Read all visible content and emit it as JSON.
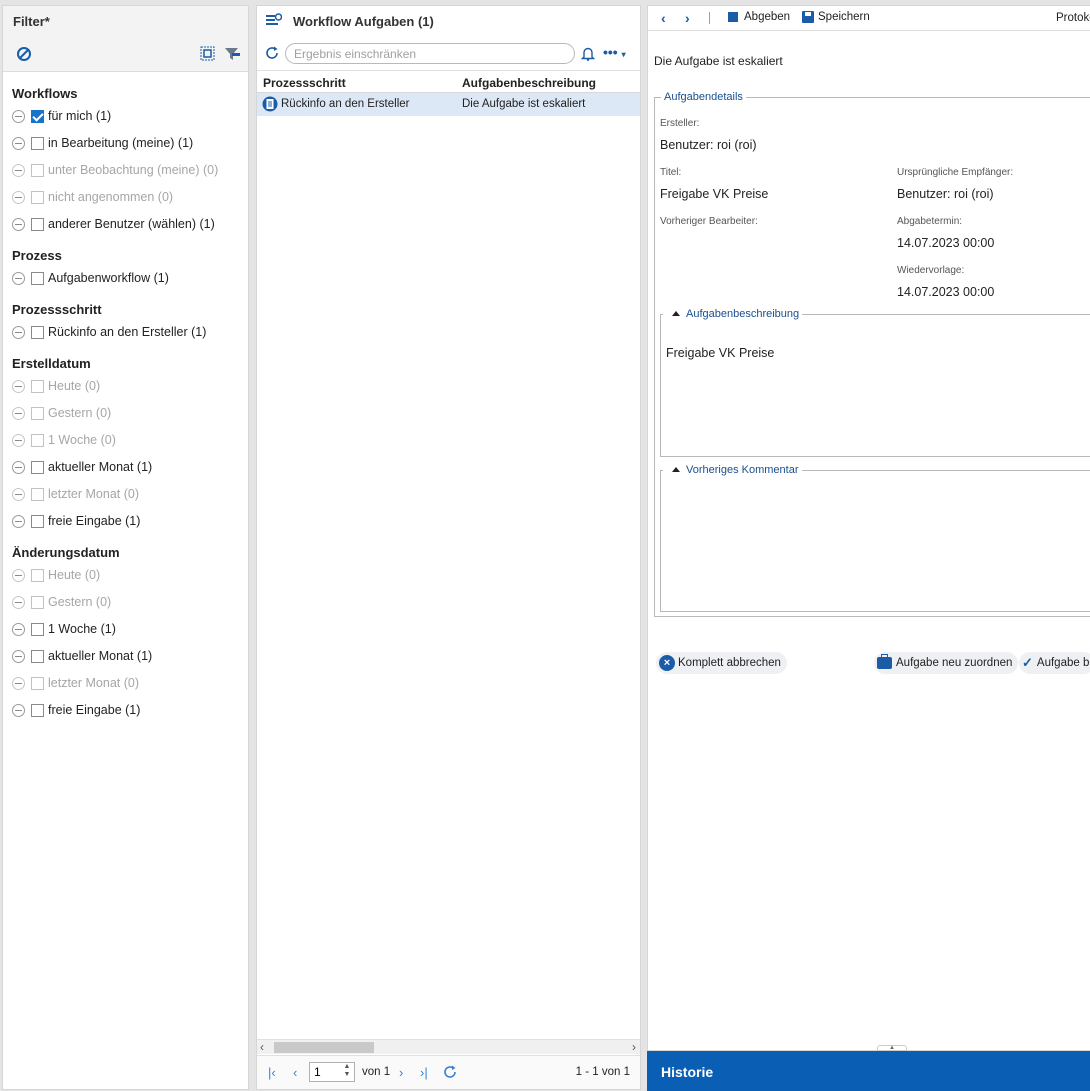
{
  "filter": {
    "title": "Filter*",
    "groups": [
      {
        "title": "Workflows",
        "items": [
          {
            "label": "für mich (1)",
            "checked": true,
            "disabled": false
          },
          {
            "label": "in Bearbeitung (meine) (1)",
            "checked": false,
            "disabled": false
          },
          {
            "label": "unter Beobachtung (meine) (0)",
            "checked": false,
            "disabled": true
          },
          {
            "label": "nicht angenommen (0)",
            "checked": false,
            "disabled": true
          },
          {
            "label": "anderer Benutzer (wählen) (1)",
            "checked": false,
            "disabled": false
          }
        ]
      },
      {
        "title": "Prozess",
        "items": [
          {
            "label": "Aufgabenworkflow (1)",
            "checked": false,
            "disabled": false
          }
        ]
      },
      {
        "title": "Prozessschritt",
        "items": [
          {
            "label": "Rückinfo an den Ersteller (1)",
            "checked": false,
            "disabled": false
          }
        ]
      },
      {
        "title": "Erstelldatum",
        "items": [
          {
            "label": "Heute (0)",
            "checked": false,
            "disabled": true
          },
          {
            "label": "Gestern (0)",
            "checked": false,
            "disabled": true
          },
          {
            "label": "1 Woche (0)",
            "checked": false,
            "disabled": true
          },
          {
            "label": "aktueller Monat (1)",
            "checked": false,
            "disabled": false
          },
          {
            "label": "letzter Monat (0)",
            "checked": false,
            "disabled": true
          },
          {
            "label": "freie Eingabe (1)",
            "checked": false,
            "disabled": false
          }
        ]
      },
      {
        "title": "Änderungsdatum",
        "items": [
          {
            "label": "Heute (0)",
            "checked": false,
            "disabled": true
          },
          {
            "label": "Gestern (0)",
            "checked": false,
            "disabled": true
          },
          {
            "label": "1 Woche (1)",
            "checked": false,
            "disabled": false
          },
          {
            "label": "aktueller Monat (1)",
            "checked": false,
            "disabled": false
          },
          {
            "label": "letzter Monat (0)",
            "checked": false,
            "disabled": true
          },
          {
            "label": "freie Eingabe (1)",
            "checked": false,
            "disabled": false
          }
        ]
      }
    ]
  },
  "list": {
    "title": "Workflow Aufgaben (1)",
    "search_placeholder": "Ergebnis einschränken",
    "more_label": "•••",
    "columns": [
      "Prozessschritt",
      "Aufgabenbeschreibung"
    ],
    "rows": [
      {
        "step": "Rückinfo an den Ersteller",
        "description": "Die Aufgabe ist eskaliert"
      }
    ],
    "pager": {
      "page": "1",
      "of_label": "von 1",
      "count_label": "1 - 1 von 1"
    }
  },
  "detail": {
    "toolbar": {
      "submit_label": "Abgeben",
      "save_label": "Speichern",
      "right_label": "Protoko"
    },
    "status": "Die Aufgabe ist eskaliert",
    "details_legend": "Aufgabendetails",
    "fields": {
      "creator_label": "Ersteller:",
      "creator_value": "Benutzer: roi (roi)",
      "title_label": "Titel:",
      "title_value": "Freigabe VK Preise",
      "original_recipient_label": "Ursprüngliche Empfänger:",
      "original_recipient_value": "Benutzer: roi (roi)",
      "prev_editor_label": "Vorheriger Bearbeiter:",
      "due_label": "Abgabetermin:",
      "due_value": "14.07.2023 00:00",
      "resubmit_label": "Wiedervorlage:",
      "resubmit_value": "14.07.2023 00:00"
    },
    "description_legend": "Aufgabenbeschreibung",
    "description_text": "Freigabe VK Preise",
    "comment_legend": "Vorheriges Kommentar",
    "actions": {
      "cancel_all": "Komplett abbrechen",
      "reassign": "Aufgabe neu zuordnen",
      "complete": "Aufgabe b"
    },
    "history_label": "Historie"
  },
  "colors": {
    "accent": "#1a5ca8",
    "selected_row": "#dce8f6",
    "history_bar": "#0a5fb5"
  }
}
